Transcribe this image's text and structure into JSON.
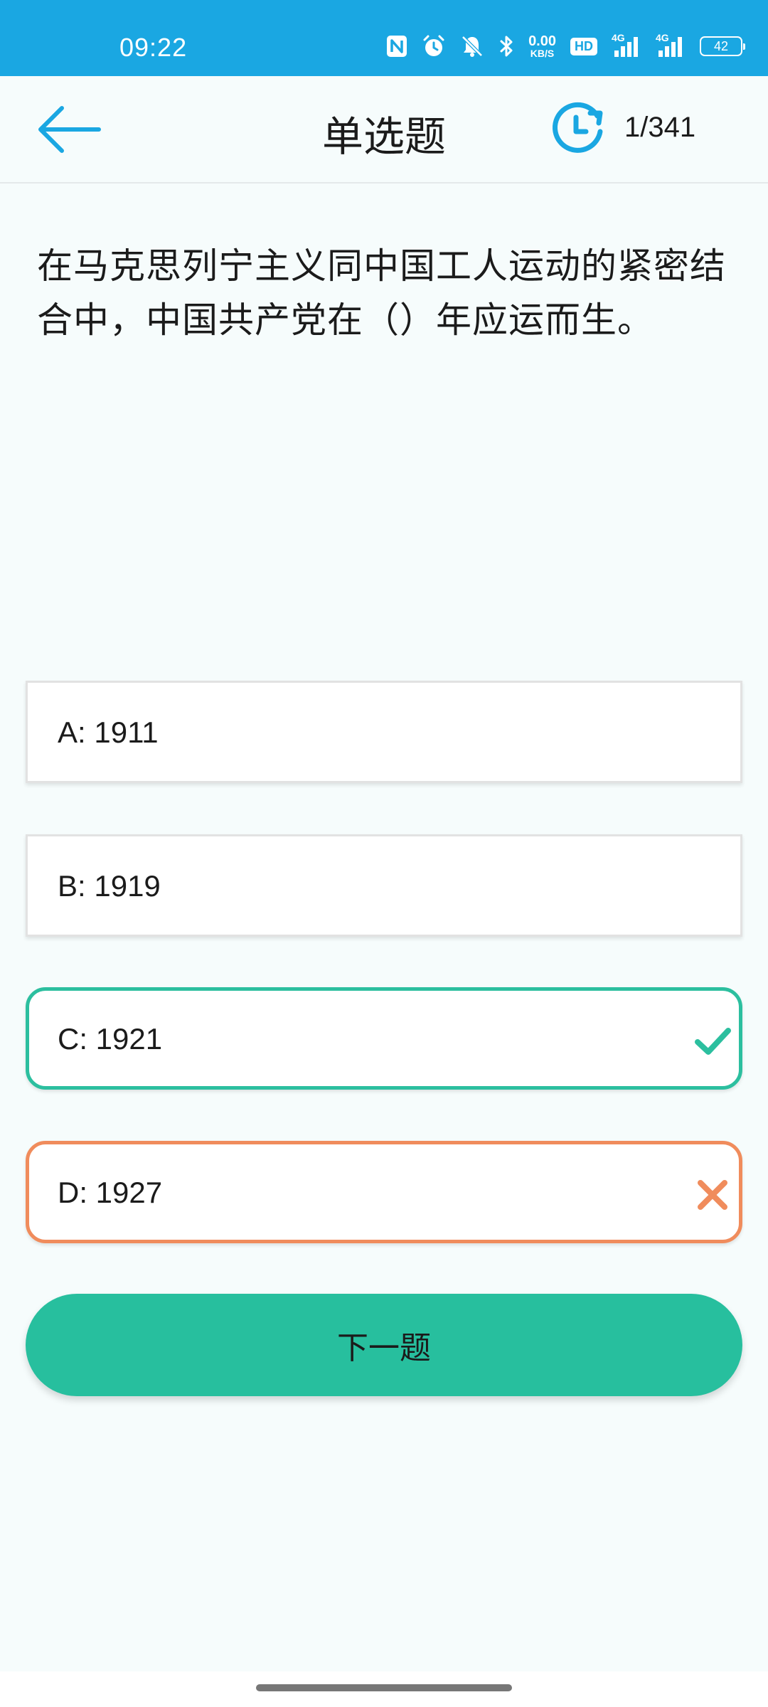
{
  "status_bar": {
    "time": "09:22",
    "net_speed_value": "0.00",
    "net_speed_unit": "KB/S",
    "hd_label": "HD",
    "network_1": "4G",
    "network_2": "4G",
    "battery": "42",
    "icons": [
      "nfc-icon",
      "alarm-icon",
      "mute-icon",
      "bluetooth-icon",
      "hd-icon",
      "signal-icon",
      "signal-icon"
    ]
  },
  "header": {
    "title": "单选题",
    "progress": "1/341",
    "back_icon": "back-arrow-icon",
    "timer_icon": "timer-icon"
  },
  "question": {
    "text": "在马克思列宁主义同中国工人运动的紧密结合中，中国共产党在（）年应运而生。"
  },
  "options": [
    {
      "label": "A: 1911",
      "state": "normal"
    },
    {
      "label": "B: 1919",
      "state": "normal"
    },
    {
      "label": "C: 1921",
      "state": "correct"
    },
    {
      "label": "D: 1927",
      "state": "wrong"
    }
  ],
  "next_button": {
    "label": "下一题"
  },
  "colors": {
    "status_bar": "#1aa7e2",
    "accent": "#1aa7e2",
    "correct": "#2cbf9f",
    "wrong": "#f08c5c",
    "button": "#27bf9e",
    "background": "#f6fcfc"
  }
}
